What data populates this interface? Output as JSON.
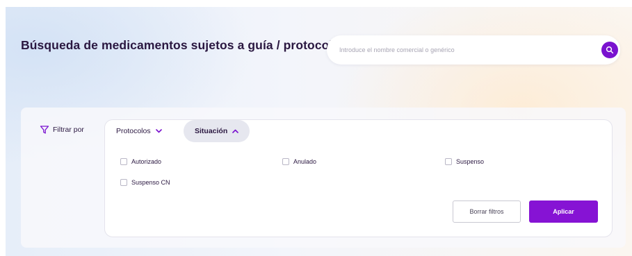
{
  "header": {
    "title": "Búsqueda de medicamentos sujetos a guía / protocolo"
  },
  "search": {
    "placeholder": "Introduce el nombre comercial o genérico",
    "value": "",
    "button_icon": "search-icon"
  },
  "filter": {
    "label": "Filtrar por",
    "icon": "funnel-icon",
    "tabs": [
      {
        "label": "Protocolos",
        "icon": "chevron-down-icon",
        "active": false
      },
      {
        "label": "Situación",
        "icon": "chevron-up-icon",
        "active": true
      }
    ],
    "options": [
      {
        "label": "Autorizado",
        "checked": false
      },
      {
        "label": "Anulado",
        "checked": false
      },
      {
        "label": "Suspenso",
        "checked": false
      },
      {
        "label": "Suspenso CN",
        "checked": false
      }
    ],
    "clear_label": "Borrar filtros",
    "apply_label": "Aplicar"
  },
  "colors": {
    "accent": "#8613d4",
    "title_text": "#2a1740",
    "tab_active_bg": "#e6e7ef"
  }
}
